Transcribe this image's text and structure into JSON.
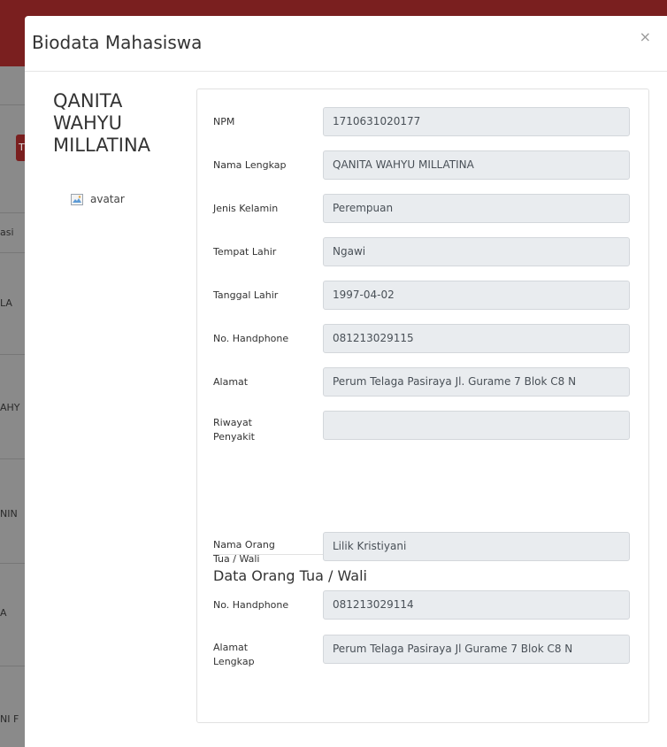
{
  "background": {
    "fragments": [
      "T",
      "asi",
      "LA",
      "AHY",
      "NIN",
      "A",
      "NI F"
    ]
  },
  "modal": {
    "title": "Biodata Mahasiswa",
    "close_label": "×"
  },
  "profile": {
    "name_lines": [
      "QANITA",
      "WAHYU",
      "MILLATINA"
    ],
    "avatar_alt": "avatar"
  },
  "student": {
    "npm": {
      "label": "NPM",
      "value": "1710631020177"
    },
    "full_name": {
      "label": "Nama Lengkap",
      "value": "QANITA WAHYU MILLATINA"
    },
    "gender": {
      "label": "Jenis Kelamin",
      "value": "Perempuan"
    },
    "birthplace": {
      "label": "Tempat Lahir",
      "value": "Ngawi"
    },
    "birthdate": {
      "label": "Tanggal Lahir",
      "value": "1997-04-02"
    },
    "phone": {
      "label": "No. Handphone",
      "value": "081213029115"
    },
    "address": {
      "label": "Alamat",
      "value": "Perum Telaga Pasiraya Jl. Gurame 7 Blok C8 N"
    },
    "medical_history": {
      "label_line1": "Riwayat",
      "label_line2": "Penyakit",
      "value": ""
    }
  },
  "guardian": {
    "section_title": "Data Orang Tua / Wali",
    "name": {
      "label_line1": "Nama Orang",
      "label_line2": "Tua / Wali",
      "value": "Lilik Kristiyani"
    },
    "phone": {
      "label": "No. Handphone",
      "value": "081213029114"
    },
    "address": {
      "label_line1": "Alamat",
      "label_line2": "Lengkap",
      "value": "Perum Telaga Pasiraya Jl Gurame 7 Blok C8 N"
    }
  }
}
